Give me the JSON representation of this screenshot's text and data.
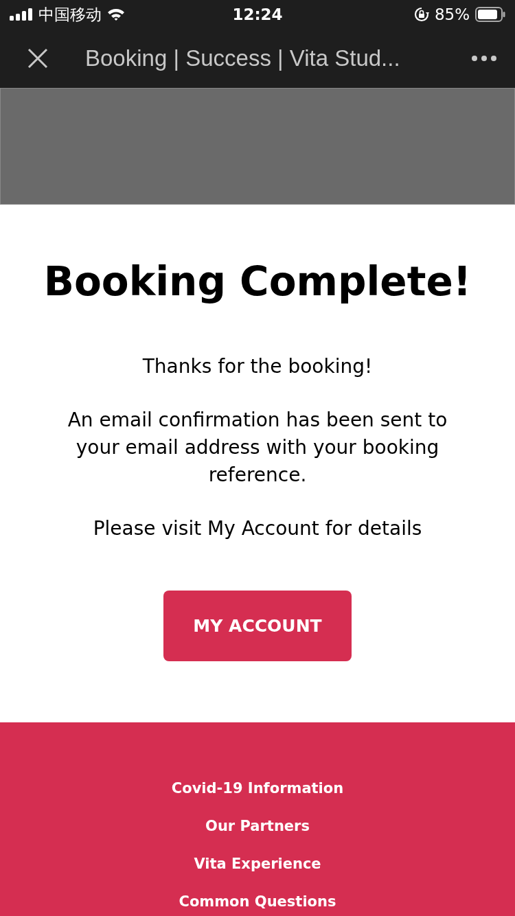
{
  "status_bar": {
    "carrier": "中国移动",
    "time": "12:24",
    "battery": "85%"
  },
  "nav_bar": {
    "title": "Booking | Success | Vita Stud..."
  },
  "heading": "Booking Complete!",
  "paragraphs": [
    "Thanks for the booking!",
    "An email confirmation has been sent to your email address with your booking reference.",
    "Please visit My Account for details"
  ],
  "button": "MY ACCOUNT",
  "footer_links": [
    "Covid-19 Information",
    "Our Partners",
    "Vita Experience",
    "Common Questions"
  ]
}
